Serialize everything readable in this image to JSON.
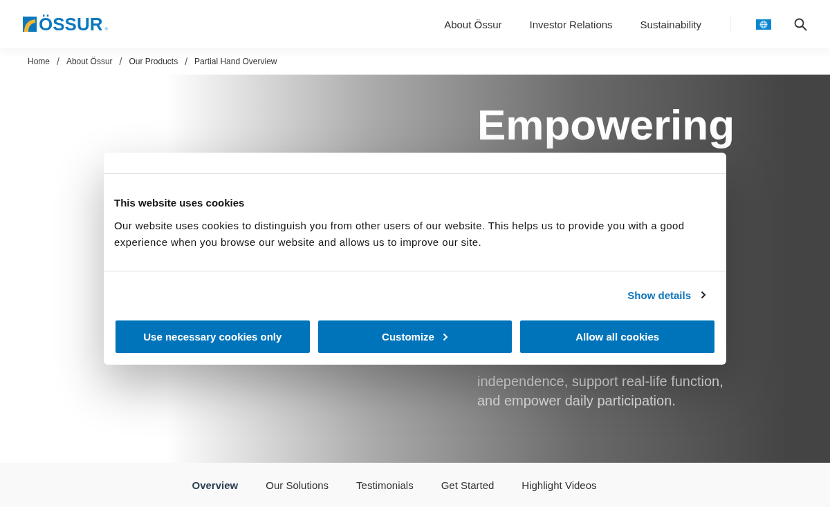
{
  "header": {
    "logo": {
      "text": "ÖSSUR",
      "mark": "®"
    },
    "nav": [
      "About Össur",
      "Investor Relations",
      "Sustainability"
    ]
  },
  "breadcrumbs": [
    "Home",
    "About Össur",
    "Our Products",
    "Partial Hand Overview"
  ],
  "breadcrumb_separator": "/",
  "hero": {
    "title": "Empowering",
    "text": "independence, support real-life function, and empower daily participation."
  },
  "cookie_dialog": {
    "title": "This website uses cookies",
    "text": "Our website uses cookies to distinguish you from other users of our website. This helps us to provide you with a good experience when you browse our website and allows us to improve our site.",
    "details_link": "Show details",
    "buttons": [
      {
        "label": "Use necessary cookies only",
        "kind": "plain"
      },
      {
        "label": "Customize",
        "kind": "chevron"
      },
      {
        "label": "Allow all cookies",
        "kind": "plain"
      }
    ]
  },
  "section_tabs": [
    {
      "label": "Overview",
      "selected": true
    },
    {
      "label": "Our Solutions",
      "selected": false
    },
    {
      "label": "Testimonials",
      "selected": false
    },
    {
      "label": "Get Started",
      "selected": false
    },
    {
      "label": "Highlight Videos",
      "selected": false
    }
  ]
}
